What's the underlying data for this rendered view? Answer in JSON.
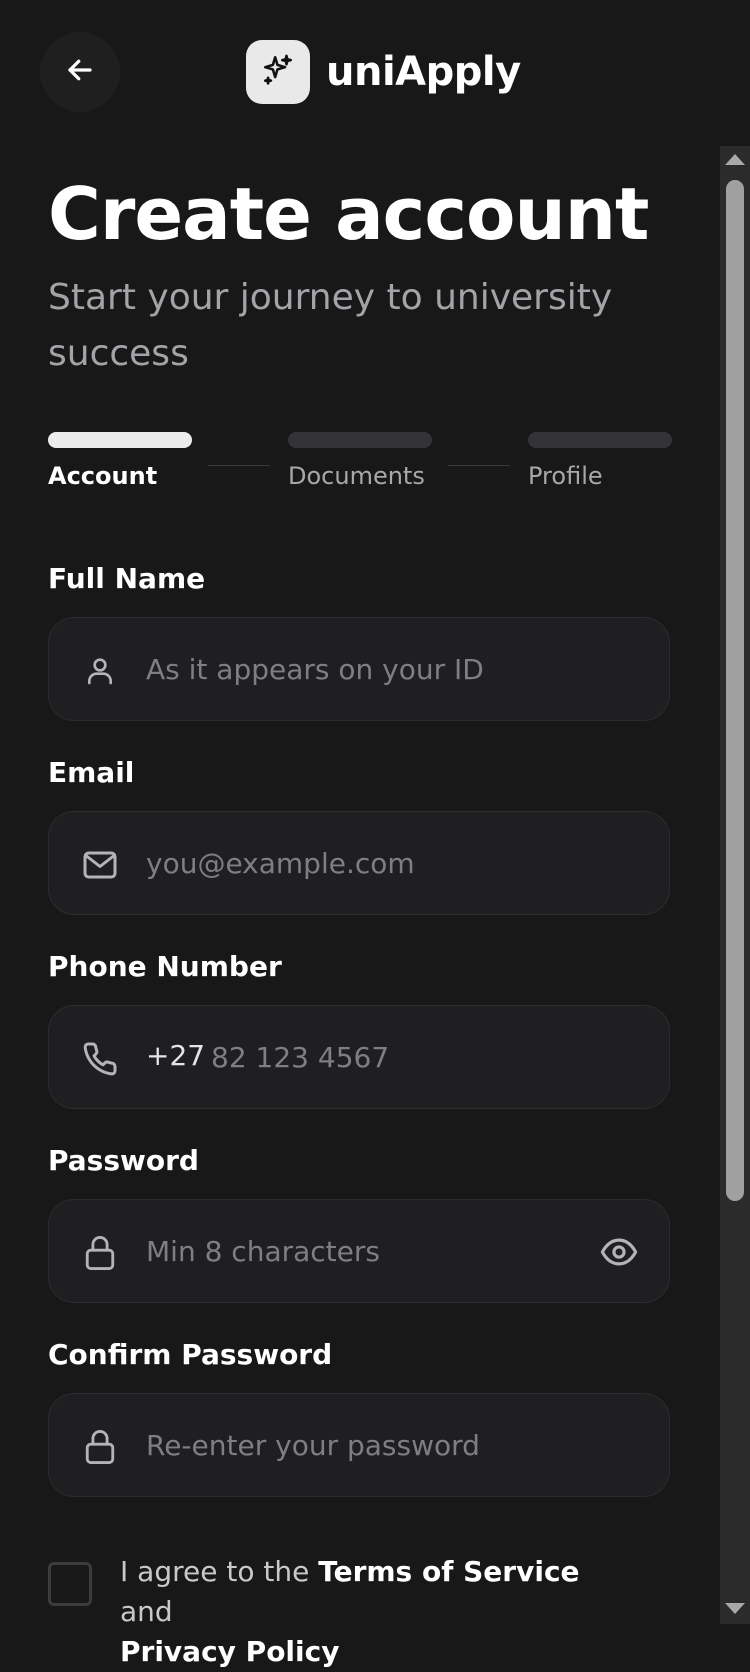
{
  "header": {
    "back_icon": "arrow-left-icon",
    "logo_icon": "sparkles-icon",
    "brand_name": "uniApply"
  },
  "page": {
    "title": "Create account",
    "subtitle": "Start your journey to university success"
  },
  "steps": [
    {
      "label": "Account",
      "active": true
    },
    {
      "label": "Documents",
      "active": false
    },
    {
      "label": "Profile",
      "active": false
    }
  ],
  "form": {
    "full_name": {
      "label": "Full Name",
      "placeholder": "As it appears on your ID",
      "icon": "user-icon"
    },
    "email": {
      "label": "Email",
      "placeholder": "you@example.com",
      "icon": "mail-icon"
    },
    "phone": {
      "label": "Phone Number",
      "prefix": "+27",
      "placeholder": "82 123 4567",
      "icon": "phone-icon"
    },
    "password": {
      "label": "Password",
      "placeholder": "Min 8 characters",
      "icon": "lock-icon",
      "toggle_icon": "eye-icon"
    },
    "confirm_password": {
      "label": "Confirm Password",
      "placeholder": "Re-enter your password",
      "icon": "lock-icon"
    }
  },
  "terms": {
    "prefix": "I agree to the ",
    "terms_link": "Terms of Service",
    "conjunction": " and",
    "privacy_link": "Privacy Policy",
    "checked": false
  },
  "colors": {
    "background": "#181818",
    "field_bg": "#1f1f21",
    "active_step": "#ececec",
    "inactive_step": "#333336",
    "muted_text": "#a3a3a8"
  }
}
